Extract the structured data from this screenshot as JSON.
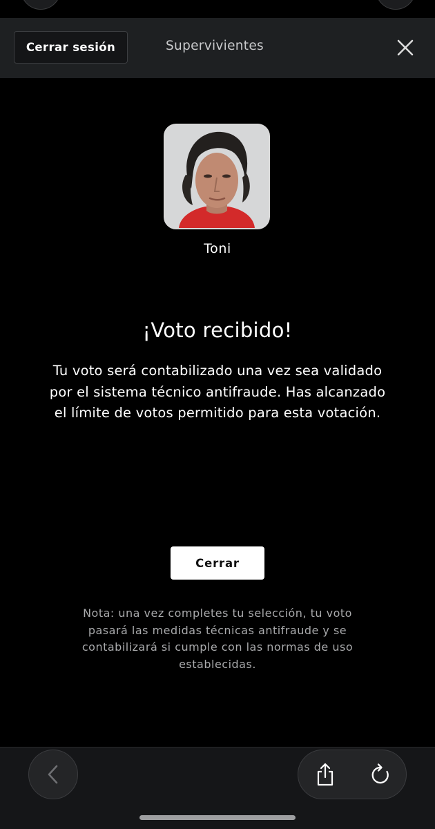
{
  "header": {
    "logout_label": "Cerrar sesión",
    "title": "Supervivientes"
  },
  "candidate": {
    "name": "Toni"
  },
  "confirmation": {
    "title": "¡Voto recibido!",
    "message": "Tu voto será contabilizado una vez sea validado por el sistema técnico antifraude. Has alcanzado el límite de votos permitido para esta votación.",
    "close_label": "Cerrar",
    "note": "Nota: una vez completes tu selección, tu voto pasará las medidas técnicas antifraude y se contabilizará si cumple con las normas de uso establecidas."
  },
  "icons": {
    "close": "close-icon",
    "back": "chevron-left-icon",
    "share": "share-icon",
    "reload": "reload-icon"
  },
  "colors": {
    "background": "#000000",
    "header_bg": "#1e2022",
    "primary_button_bg": "#ffffff",
    "note_text": "#a9aaac"
  }
}
